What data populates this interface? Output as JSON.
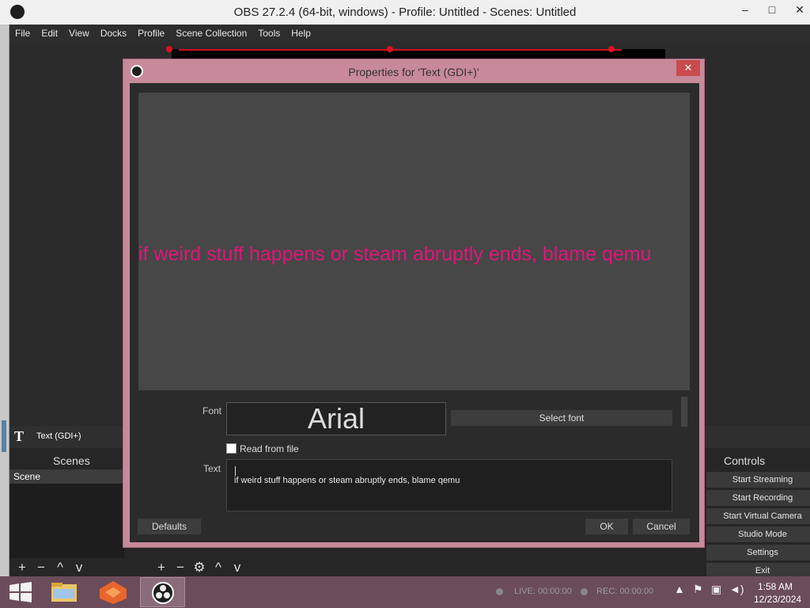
{
  "window": {
    "title": "OBS 27.2.4 (64-bit, windows) - Profile: Untitled - Scenes: Untitled",
    "minimize": "–",
    "maximize": "□",
    "close": "✕"
  },
  "menu": [
    "File",
    "Edit",
    "View",
    "Docks",
    "Profile",
    "Scene Collection",
    "Tools",
    "Help"
  ],
  "sources": {
    "selected_source_icon": "T",
    "selected_source_label": "Text (GDI+)"
  },
  "scenes": {
    "title": "Scenes",
    "items": [
      "Scene"
    ],
    "tools": [
      "+",
      "−",
      "^",
      "v"
    ]
  },
  "source_tools": [
    "+",
    "−",
    "⚙",
    "^",
    "v"
  ],
  "controls": {
    "title": "Controls",
    "buttons": [
      "Start Streaming",
      "Start Recording",
      "Start Virtual Camera",
      "Studio Mode",
      "Settings",
      "Exit"
    ]
  },
  "dialog": {
    "title": "Properties for 'Text (GDI+)'",
    "close": "✕",
    "preview_text": "if weird stuff happens or steam abruptly ends, blame qemu",
    "preview_color": "#e0157a",
    "font_label": "Font",
    "font_value": "Arial",
    "select_font_label": "Select font",
    "read_from_file_label": "Read from file",
    "read_from_file_checked": false,
    "text_label": "Text",
    "text_value": "if weird stuff happens or steam abruptly ends, blame qemu",
    "defaults_label": "Defaults",
    "ok_label": "OK",
    "cancel_label": "Cancel"
  },
  "status": {
    "live": "LIVE: 00:00:00",
    "rec": "REC: 00:00:00"
  },
  "taskbar": {
    "time": "1:58 AM",
    "date": "12/23/2024"
  }
}
